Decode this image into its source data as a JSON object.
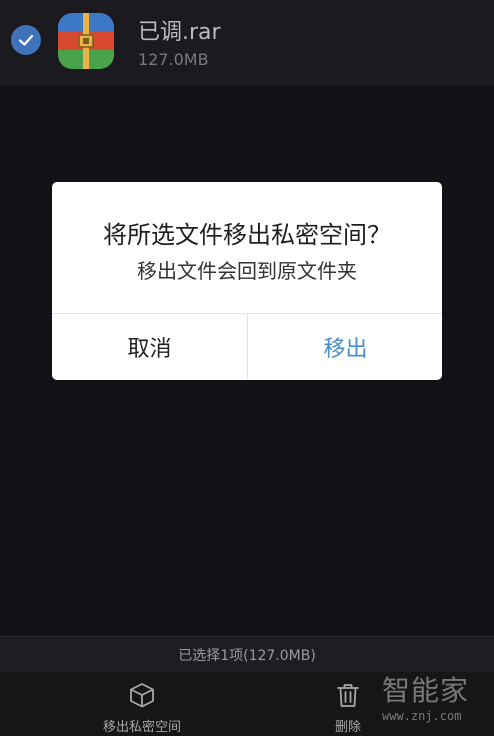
{
  "file": {
    "name": "已调.rar",
    "size": "127.0MB",
    "selected": true,
    "icon": "rar-archive-icon"
  },
  "dialog": {
    "title": "将所选文件移出私密空间？",
    "message": "移出文件会回到原文件夹",
    "cancel_label": "取消",
    "confirm_label": "移出"
  },
  "status": {
    "selection_text": "已选择1项(127.0MB)"
  },
  "toolbar": {
    "move_out_label": "移出私密空间",
    "move_out_icon": "box-icon",
    "delete_label": "删除",
    "delete_icon": "trash-icon"
  },
  "watermark": {
    "logo": "智能家",
    "url": "www.znj.com"
  },
  "colors": {
    "accent": "#4a8ec9",
    "checkbox": "#3e73b9",
    "background": "#111116"
  }
}
